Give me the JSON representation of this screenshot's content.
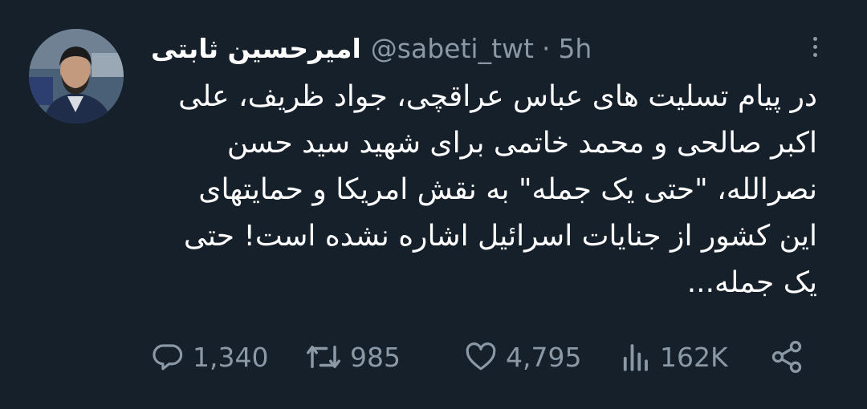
{
  "tweet": {
    "author_name": "امیرحسین ثابتی",
    "handle": "@sabeti_twt",
    "separator": "·",
    "time": "5h",
    "text_lines": [
      "در پیام تسلیت های عباس عراقچی، جواد ظریف، علی",
      "اکبر صالحی و محمد خاتمی برای شهید سید حسن",
      "نصرالله، \"حتی یک جمله\" به نقش امریکا و حمایتهای",
      "این کشور از جنایات اسرائیل اشاره نشده است! حتی",
      "یک جمله..."
    ]
  },
  "actions": {
    "replies": "1,340",
    "retweets": "985",
    "likes": "4,795",
    "views": "162K"
  },
  "icons": {
    "reply": "reply-icon",
    "retweet": "retweet-icon",
    "like": "heart-icon",
    "views": "views-icon",
    "share": "share-icon",
    "more": "more-options-icon"
  },
  "colors": {
    "background": "#15202b",
    "text": "#ffffff",
    "secondary": "#8b98a5"
  }
}
